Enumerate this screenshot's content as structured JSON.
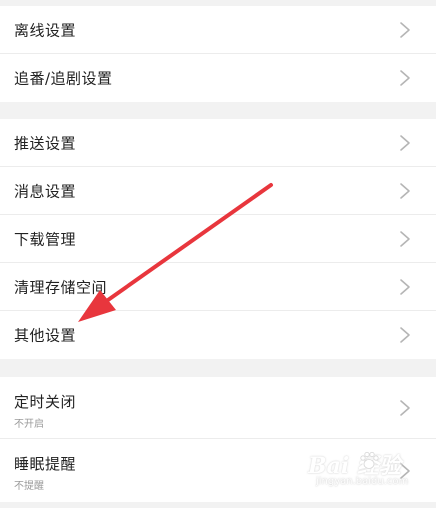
{
  "settings": {
    "group1": [
      {
        "label": "离线设置"
      },
      {
        "label": "追番/追剧设置"
      }
    ],
    "group2": [
      {
        "label": "推送设置"
      },
      {
        "label": "消息设置"
      },
      {
        "label": "下载管理"
      },
      {
        "label": "清理存储空间"
      },
      {
        "label": "其他设置"
      }
    ],
    "group3": [
      {
        "label": "定时关闭",
        "sub": "不开启"
      },
      {
        "label": "睡眠提醒",
        "sub": "不提醒"
      }
    ]
  },
  "annotation": {
    "arrow_color": "#e8363d"
  },
  "watermark": {
    "brand": "Bai  经验",
    "url": "jingyan.baidu.com"
  },
  "icons": {
    "chevron": "chevron-right-icon",
    "arrow": "red-arrow-annotation"
  }
}
